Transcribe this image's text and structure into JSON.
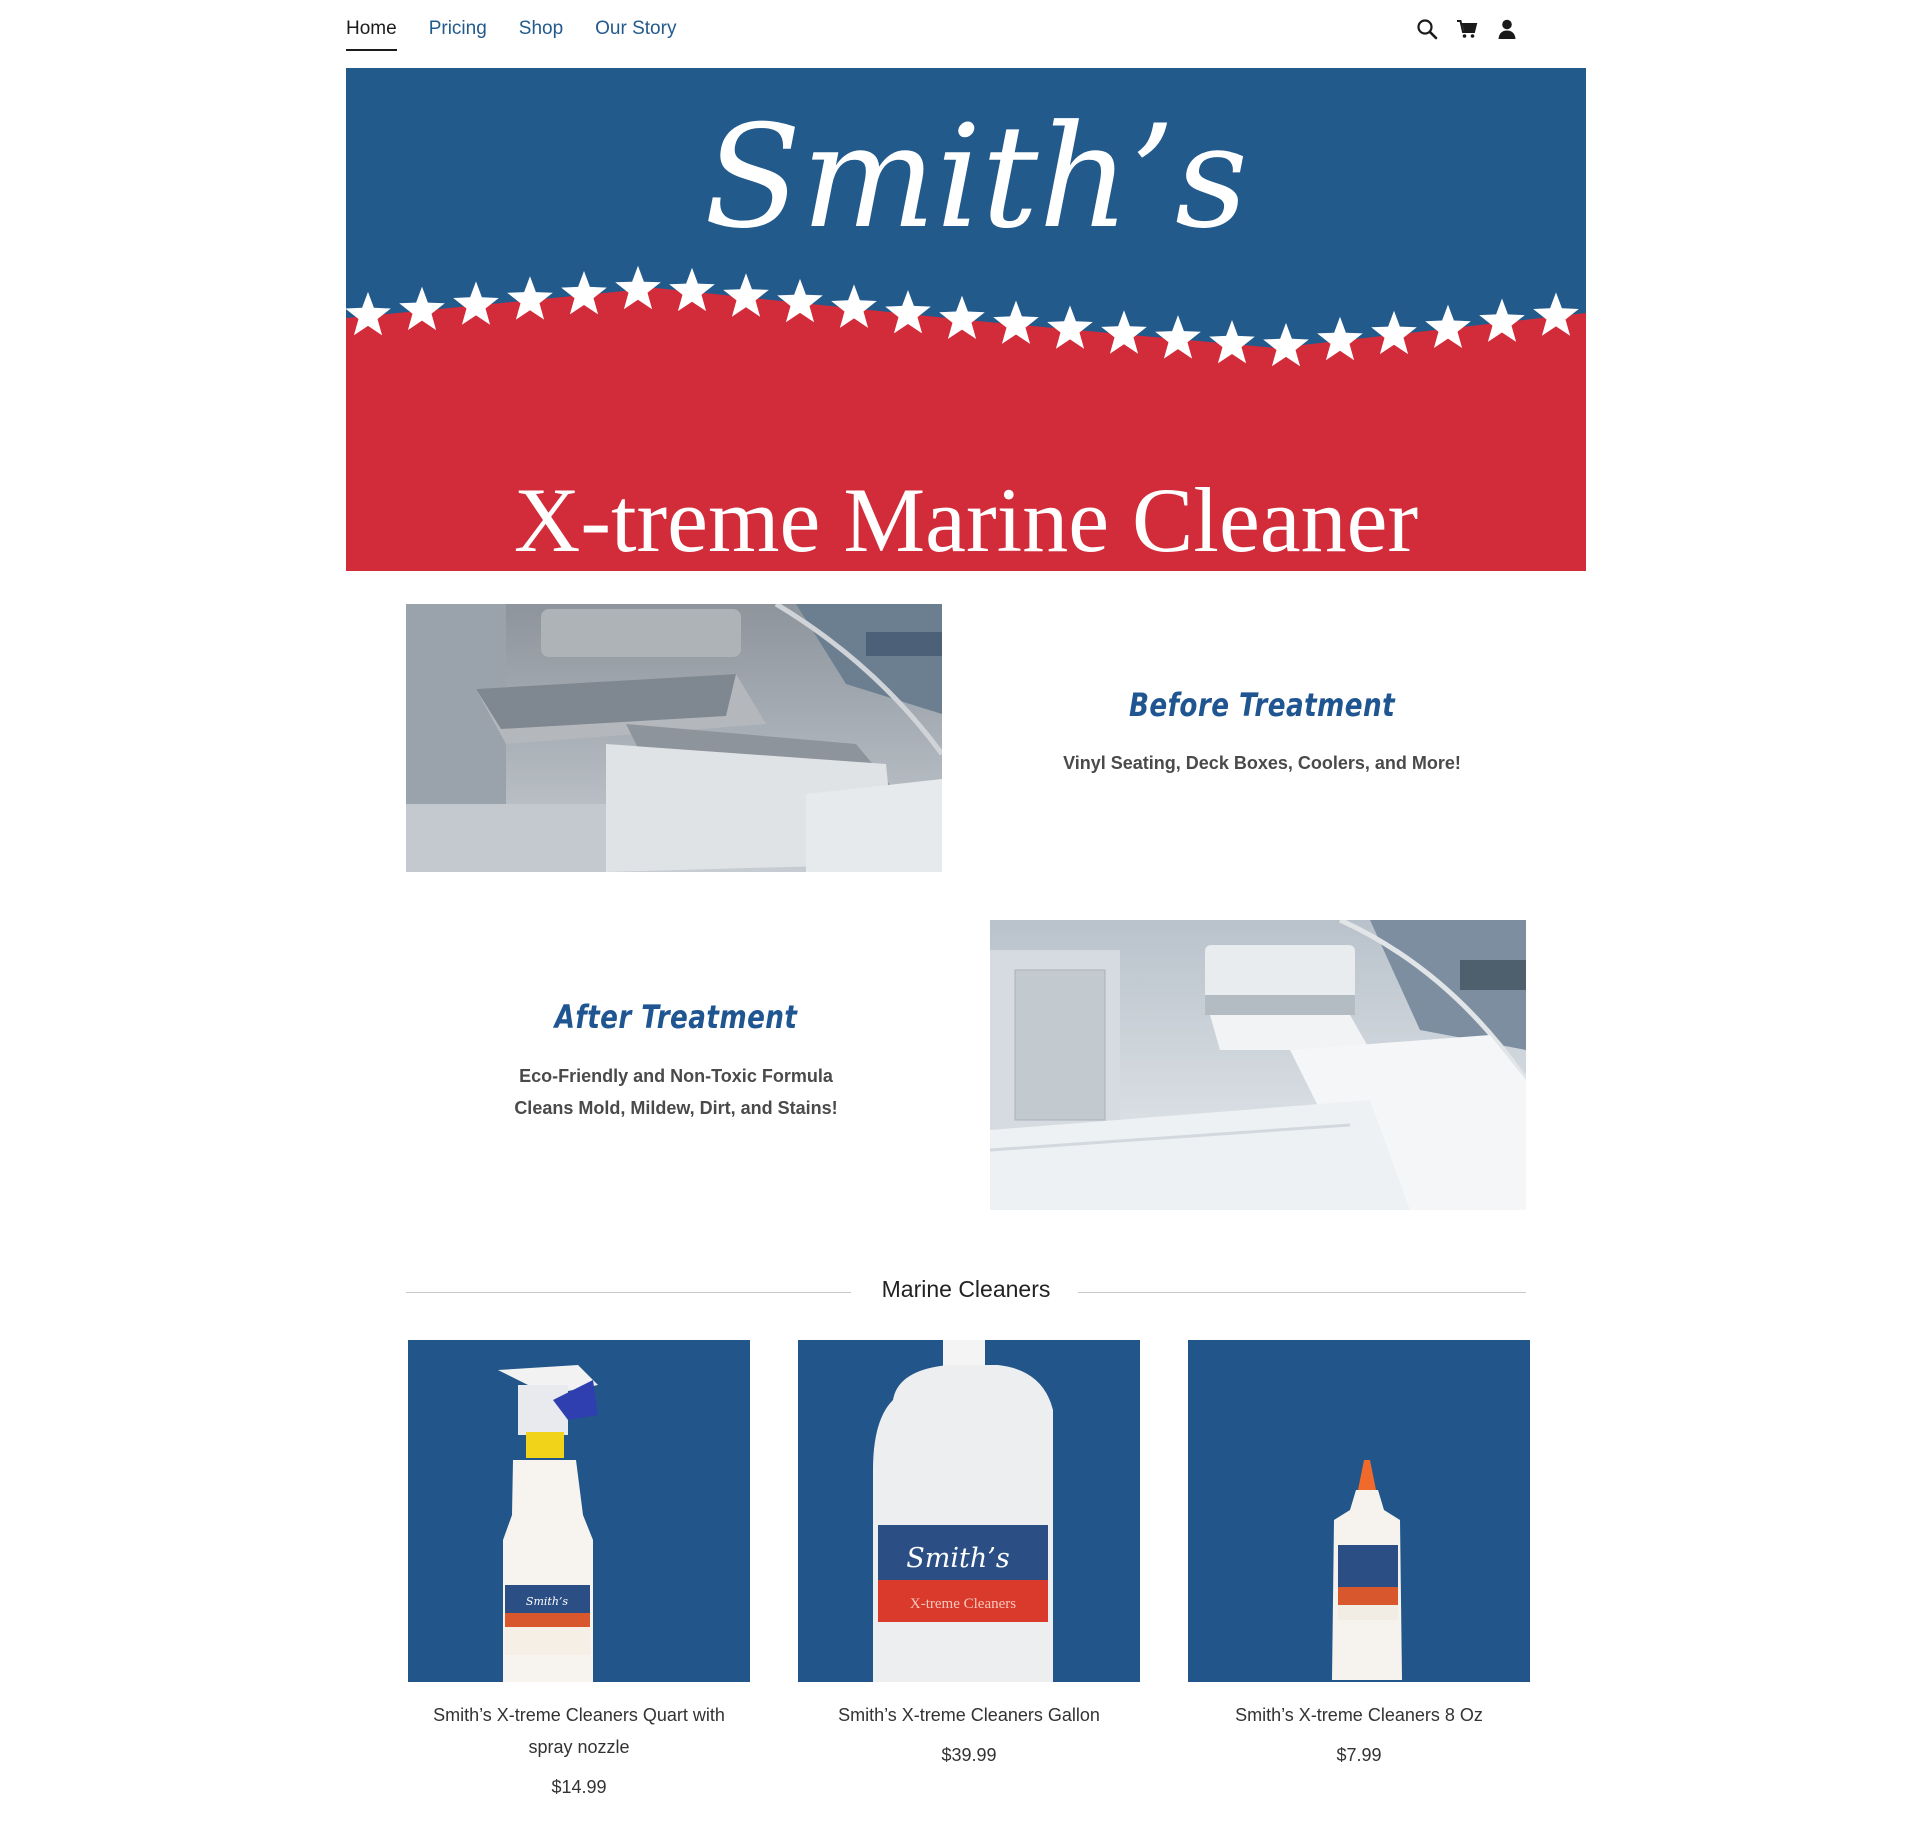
{
  "nav": {
    "items": [
      {
        "label": "Home"
      },
      {
        "label": "Pricing"
      },
      {
        "label": "Shop"
      },
      {
        "label": "Our Story"
      }
    ],
    "icons": [
      "search-icon",
      "cart-icon",
      "account-icon"
    ]
  },
  "hero": {
    "brand": "Smith’s",
    "subtitle": "X-treme Marine Cleaner",
    "colors": {
      "blue": "#235a8c",
      "red": "#d22b3a",
      "white": "#ffffff"
    }
  },
  "before": {
    "heading": "Before Treatment",
    "text": "Vinyl Seating, Deck Boxes, Coolers, and More!"
  },
  "after": {
    "heading": "After Treatment",
    "line1": "Eco-Friendly and Non-Toxic Formula",
    "line2": "Cleans Mold, Mildew, Dirt, and Stains!"
  },
  "products": {
    "section_title": "Marine Cleaners",
    "items": [
      {
        "name": "Smith’s X-treme Cleaners Quart with spray nozzle",
        "price": "$14.99"
      },
      {
        "name": "Smith’s X-treme Cleaners Gallon",
        "price": "$39.99"
      },
      {
        "name": "Smith’s X-treme Cleaners 8 Oz",
        "price": "$7.99"
      }
    ],
    "label_brand": "Smith’s",
    "label_sub": "X-treme Cleaners"
  }
}
